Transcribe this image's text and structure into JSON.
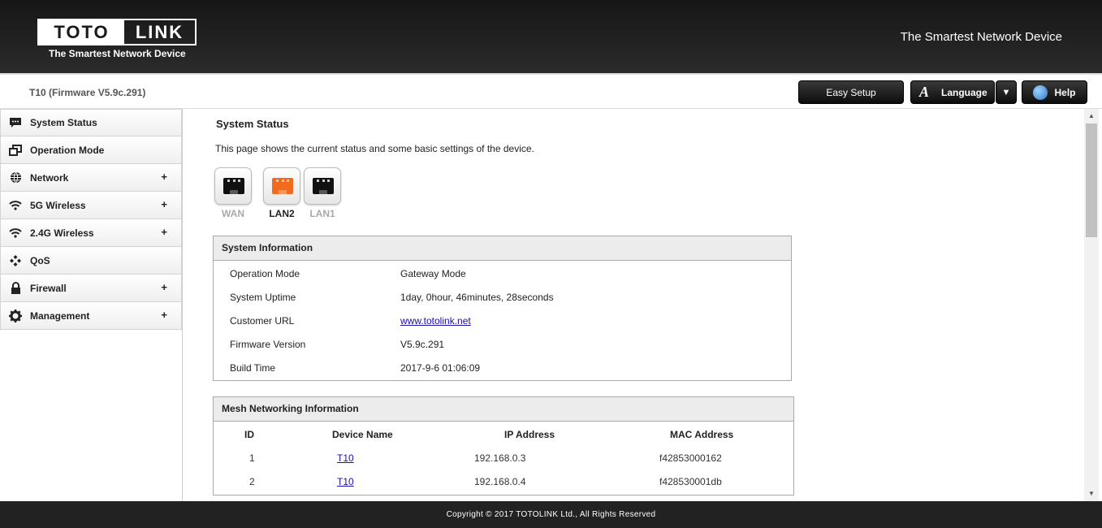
{
  "header": {
    "logo_left": "TOTO",
    "logo_right": "LINK",
    "logo_tagline": "The Smartest Network Device",
    "tagline": "The Smartest Network Device"
  },
  "subbar": {
    "device_title": "T10 (Firmware V5.9c.291)",
    "easy_setup": "Easy Setup",
    "language_icon": "A",
    "language": "Language",
    "dropdown_arrow": "▼",
    "help": "Help"
  },
  "sidebar": {
    "items": [
      {
        "label": "System Status",
        "icon": "chat-icon",
        "expand": ""
      },
      {
        "label": "Operation Mode",
        "icon": "windows-icon",
        "expand": ""
      },
      {
        "label": "Network",
        "icon": "globe-icon",
        "expand": "+"
      },
      {
        "label": "5G Wireless",
        "icon": "wifi-icon",
        "expand": "+"
      },
      {
        "label": "2.4G Wireless",
        "icon": "wifi-icon",
        "expand": "+"
      },
      {
        "label": "QoS",
        "icon": "diamond-icon",
        "expand": ""
      },
      {
        "label": "Firewall",
        "icon": "lock-icon",
        "expand": "+"
      },
      {
        "label": "Management",
        "icon": "gear-icon",
        "expand": "+"
      }
    ]
  },
  "main": {
    "title": "System Status",
    "description": "This page shows the current status and some basic settings of the device.",
    "ports": [
      {
        "label": "WAN",
        "active": false
      },
      {
        "label": "LAN2",
        "active": true
      },
      {
        "label": "LAN1",
        "active": false
      }
    ],
    "system_info": {
      "heading": "System Information",
      "rows": [
        {
          "label": "Operation Mode",
          "value": "Gateway Mode"
        },
        {
          "label": "System Uptime",
          "value": "1day, 0hour, 46minutes, 28seconds"
        },
        {
          "label": "Customer URL",
          "value": "www.totolink.net"
        },
        {
          "label": "Firmware Version",
          "value": "V5.9c.291"
        },
        {
          "label": "Build Time",
          "value": "2017-9-6 01:06:09"
        }
      ]
    },
    "mesh": {
      "heading": "Mesh Networking Information",
      "columns": [
        "ID",
        "Device Name",
        "IP Address",
        "MAC Address"
      ],
      "rows": [
        {
          "id": "1",
          "name": "T10",
          "ip": "192.168.0.3",
          "mac": "f42853000162"
        },
        {
          "id": "2",
          "name": "T10",
          "ip": "192.168.0.4",
          "mac": "f428530001db"
        }
      ]
    }
  },
  "footer": {
    "copyright": "Copyright © 2017 TOTOLINK Ltd.,   All Rights Reserved"
  },
  "colors": {
    "header_bg": "#1e1e1e",
    "active_port": "#f26a1b",
    "link": "#1a0dab"
  }
}
